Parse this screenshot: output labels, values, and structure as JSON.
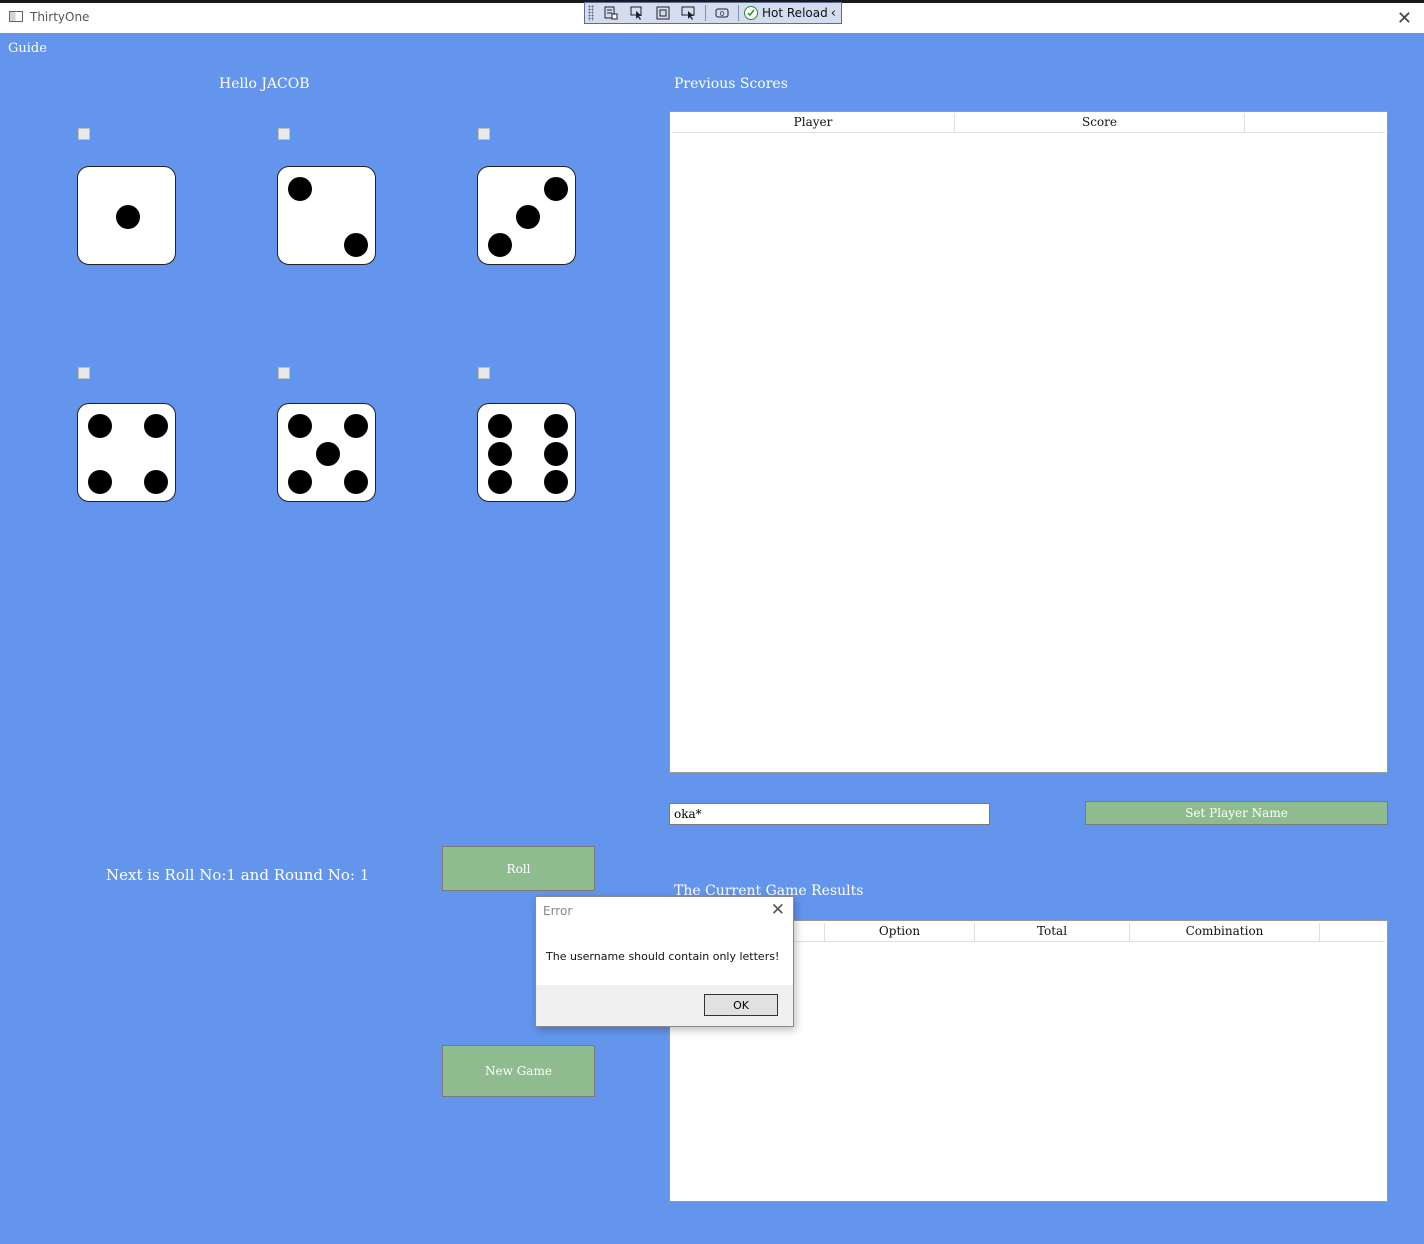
{
  "window": {
    "title": "ThirtyOne"
  },
  "debug_toolbar": {
    "hot_reload_label": "Hot Reload"
  },
  "menu": {
    "guide": "Guide"
  },
  "greeting": "Hello JACOB",
  "dice": [
    {
      "value": 1,
      "held": false
    },
    {
      "value": 2,
      "held": false
    },
    {
      "value": 3,
      "held": false
    },
    {
      "value": 4,
      "held": false
    },
    {
      "value": 5,
      "held": false
    },
    {
      "value": 6,
      "held": false
    }
  ],
  "previous_scores": {
    "title": "Previous Scores",
    "columns": [
      "Player",
      "Score",
      ""
    ],
    "rows": []
  },
  "player_name": {
    "value": "oka*",
    "button": "Set Player Name"
  },
  "status": "Next is Roll No:1 and Round No: 1",
  "buttons": {
    "roll": "Roll",
    "new_game": "New Game"
  },
  "current_results": {
    "title": "The Current Game Results",
    "columns": [
      "",
      "Option",
      "Total",
      "Combination",
      ""
    ],
    "rows": []
  },
  "error_dialog": {
    "title": "Error",
    "message": "The username should contain only letters!",
    "ok": "OK"
  }
}
